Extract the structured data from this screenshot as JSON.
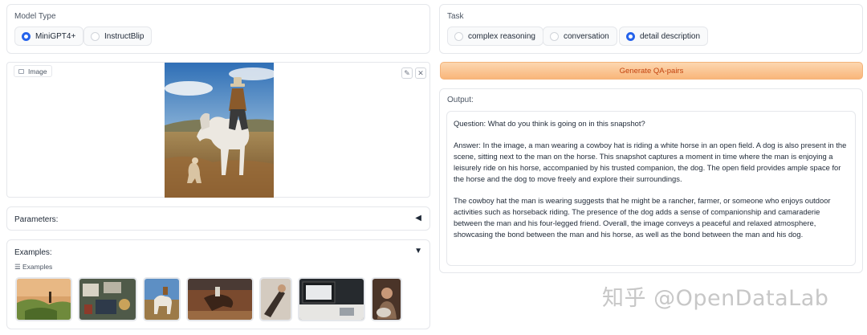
{
  "model_type": {
    "label": "Model Type",
    "options": [
      {
        "label": "MiniGPT4+",
        "selected": true
      },
      {
        "label": "InstructBlip",
        "selected": false
      }
    ]
  },
  "task": {
    "label": "Task",
    "options": [
      {
        "label": "complex reasoning",
        "selected": false
      },
      {
        "label": "conversation",
        "selected": false
      },
      {
        "label": "detail description",
        "selected": true
      }
    ]
  },
  "image_panel": {
    "label": "Image",
    "edit_icon": "pencil-icon",
    "clear_icon": "close-icon"
  },
  "generate_button": {
    "label": "Generate QA-pairs"
  },
  "output": {
    "label": "Output:",
    "question": "Question: What do you think is going on in this snapshot?",
    "answer_1": "Answer: In the image, a man wearing a cowboy hat is riding a white horse in an open field. A dog is also present in the scene, sitting next to the man on the horse. This snapshot captures a moment in time where the man is enjoying a leisurely ride on his horse, accompanied by his trusted companion, the dog. The open field provides ample space for the horse and the dog to move freely and explore their surroundings.",
    "answer_2": "The cowboy hat the man is wearing suggests that he might be a rancher, farmer, or someone who enjoys outdoor activities such as horseback riding. The presence of the dog adds a sense of companionship and camaraderie between the man and his four-legged friend. Overall, the image conveys a peaceful and relaxed atmosphere, showcasing the bond between the man and his horse, as well as the bond between the man and his dog."
  },
  "parameters": {
    "label": "Parameters:",
    "toggle": "◀"
  },
  "examples": {
    "label": "Examples:",
    "toggle": "▼",
    "sub_label": "Examples"
  },
  "watermark": "知乎 @OpenDataLab",
  "colors": {
    "accent": "#2563eb",
    "button_bg": "#f9b67a",
    "button_text": "#c2410c"
  }
}
